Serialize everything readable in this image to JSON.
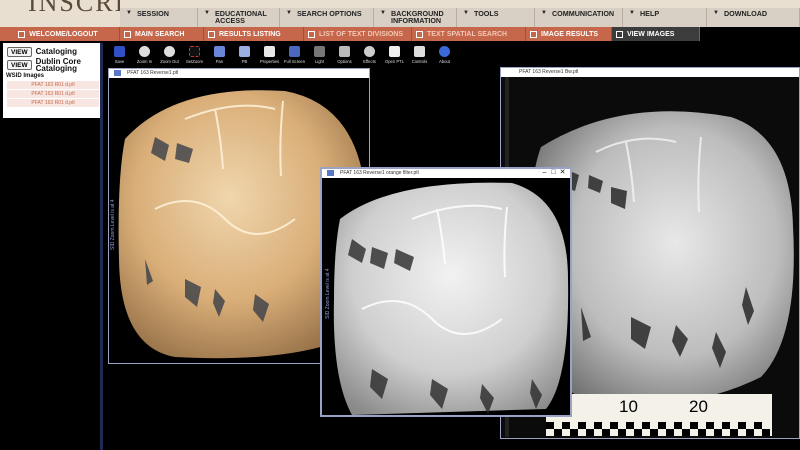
{
  "app": {
    "logo": "INSCRIPTIFACT"
  },
  "top_nav": [
    {
      "label": "SESSION"
    },
    {
      "label": "EDUCATIONAL ACCESS"
    },
    {
      "label": "SEARCH OPTIONS"
    },
    {
      "label": "BACKGROUND INFORMATION"
    },
    {
      "label": "TOOLS"
    },
    {
      "label": "COMMUNICATION"
    },
    {
      "label": "HELP"
    },
    {
      "label": "DOWNLOAD"
    }
  ],
  "sec_nav": [
    {
      "label": "WELCOME/LOGOUT"
    },
    {
      "label": "MAIN SEARCH"
    },
    {
      "label": "RESULTS LISTING"
    },
    {
      "label": "LIST OF TEXT DIVISIONS"
    },
    {
      "label": "TEXT SPATIAL SEARCH"
    },
    {
      "label": "IMAGE RESULTS"
    },
    {
      "label": "VIEW IMAGES"
    }
  ],
  "left_panel": {
    "tab1": {
      "button": "VIEW",
      "label": "Cataloging"
    },
    "tab2": {
      "button": "VIEW",
      "label": "Dublin Core Cataloging"
    },
    "list_title": "WSID Images",
    "items": [
      "PFAT 163 R01 d.ptl",
      "PFAT 163 R01 d.ptl",
      "PFAT 163 R01 d.ptl"
    ]
  },
  "toolbar": [
    {
      "label": "Save",
      "icon": "save-icon"
    },
    {
      "label": "Zoom In",
      "icon": "zoom-in-icon"
    },
    {
      "label": "Zoom Out",
      "icon": "zoom-out-icon"
    },
    {
      "label": "SetZoom",
      "icon": "set-zoom-icon"
    },
    {
      "label": "Pan",
      "icon": "pan-hand-icon"
    },
    {
      "label": "PB",
      "icon": "pb-icon"
    },
    {
      "label": "Properties",
      "icon": "properties-icon"
    },
    {
      "label": "Full Screen",
      "icon": "full-screen-icon"
    },
    {
      "label": "Light",
      "icon": "light-icon"
    },
    {
      "label": "Options",
      "icon": "options-icon"
    },
    {
      "label": "Effects",
      "icon": "effects-icon"
    },
    {
      "label": "Open PTL",
      "icon": "open-ptl-icon"
    },
    {
      "label": "Controls",
      "icon": "controls-icon"
    },
    {
      "label": "About",
      "icon": "about-icon"
    }
  ],
  "windows": {
    "window1": {
      "title": "PFAT 163 Reverse1.ptl",
      "zoom": "SID Zoom Level is at 4"
    },
    "window2": {
      "title": "PFAT 163 Reverse1 orange filter.ptl",
      "zoom": "SID Zoom Level is at 4"
    },
    "window3": {
      "title": "PFAT 163 Reverse1 Bw.ptl"
    }
  },
  "scale": {
    "n10": "10",
    "n20": "20"
  },
  "colors": {
    "nav_red": "#c6664a",
    "nav_beige": "#d8d0c4",
    "window_border": "#9aa3c6"
  }
}
